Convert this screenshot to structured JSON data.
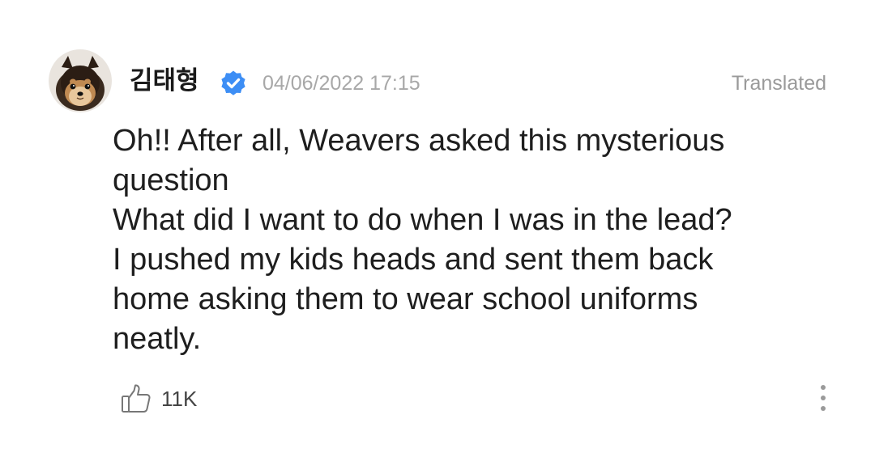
{
  "post": {
    "author": {
      "name": "김태형",
      "verified": true,
      "avatar_icon": "pomeranian-dog-avatar"
    },
    "timestamp": "04/06/2022 17:15",
    "translated_label": "Translated",
    "body_lines": [
      "Oh!! After all, Weavers asked this mysterious",
      "question",
      "What did I want to do when I was in the lead?",
      "I pushed my kids heads and sent them back",
      "home asking them to wear school uniforms",
      "neatly."
    ],
    "likes": "11K",
    "icons": {
      "verified": "verified-badge-icon",
      "like": "thumbs-up-icon",
      "more": "more-vertical-icon"
    },
    "colors": {
      "verified_badge": "#3d8ef5",
      "muted_text": "#a8a8a8",
      "body_text": "#1e1e1e"
    }
  }
}
